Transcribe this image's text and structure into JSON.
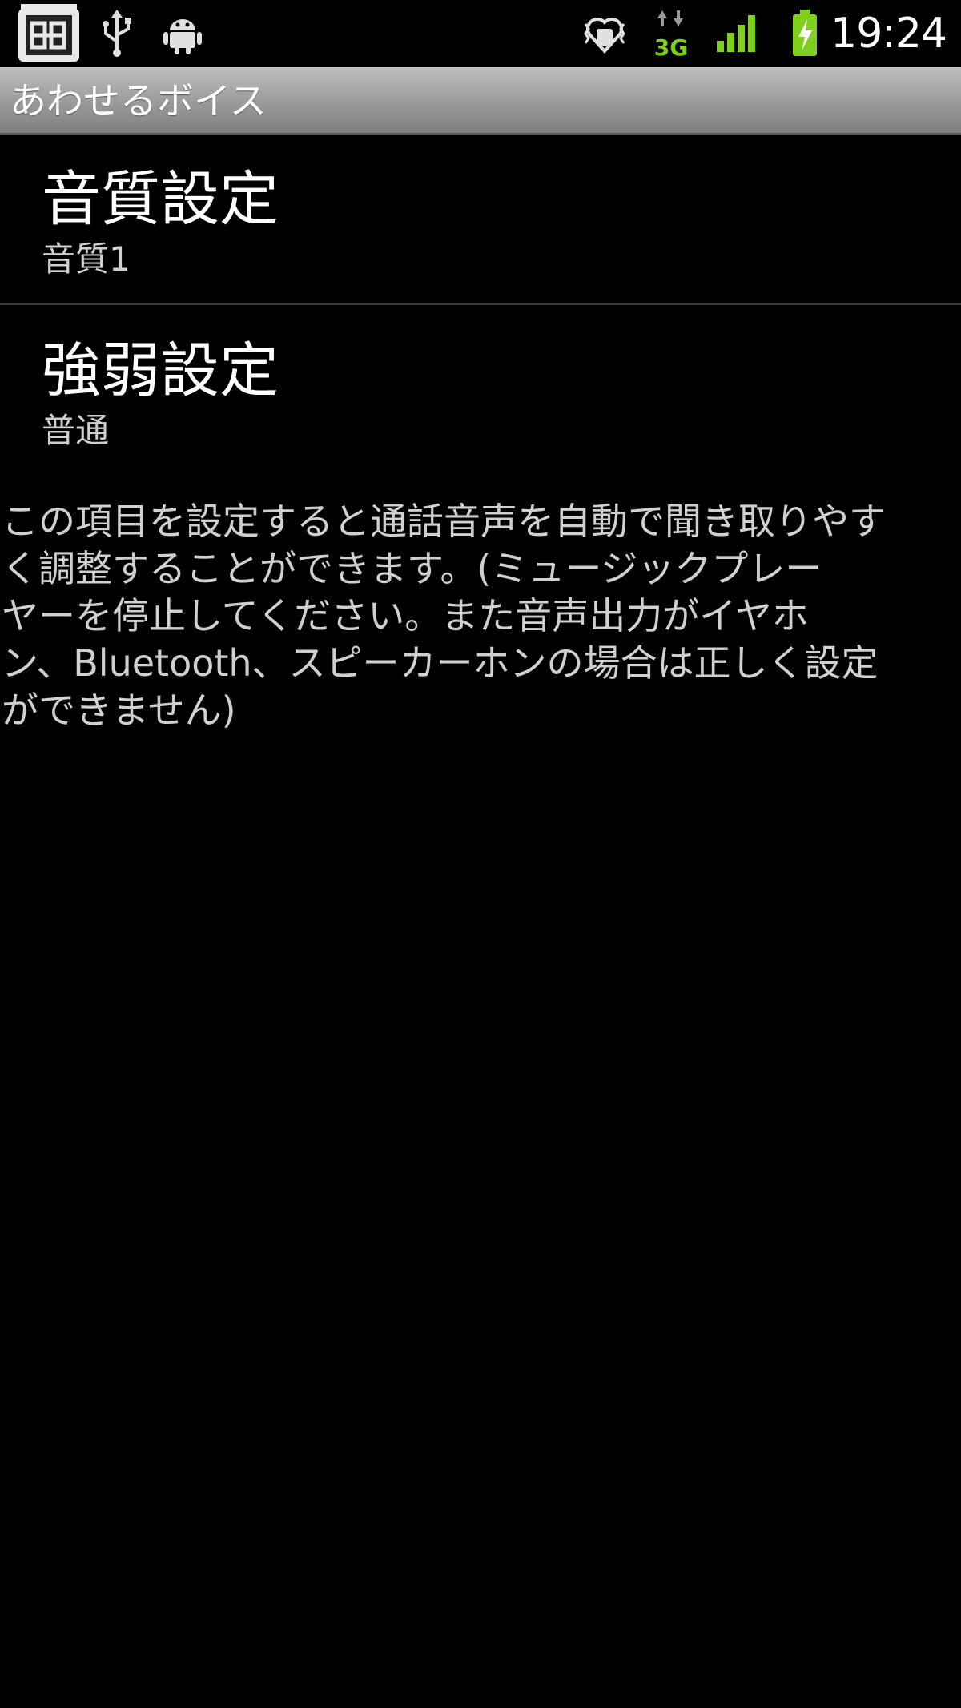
{
  "status_bar": {
    "icons_left": [
      "app-box-icon",
      "usb-icon",
      "android-debug-icon"
    ],
    "icons_right": [
      "vibrate-heart-icon",
      "network-3g-icon",
      "signal-strength-icon",
      "battery-charging-icon"
    ],
    "network_label": "3G",
    "time": "19:24",
    "accent_green": "#7fcf1f"
  },
  "title_bar": {
    "title": "あわせるボイス"
  },
  "preferences": [
    {
      "title": "音質設定",
      "summary": "音質1"
    },
    {
      "title": "強弱設定",
      "summary": "普通"
    }
  ],
  "description": {
    "lines": [
      "この項目を設定すると通話音声を自動で聞き取りやす",
      "く調整することができます。(ミュージックプレー",
      "ヤーを停止してください。また音声出力がイヤホ",
      "ン、Bluetooth、スピーカーホンの場合は正しく設定",
      "ができません)"
    ]
  }
}
